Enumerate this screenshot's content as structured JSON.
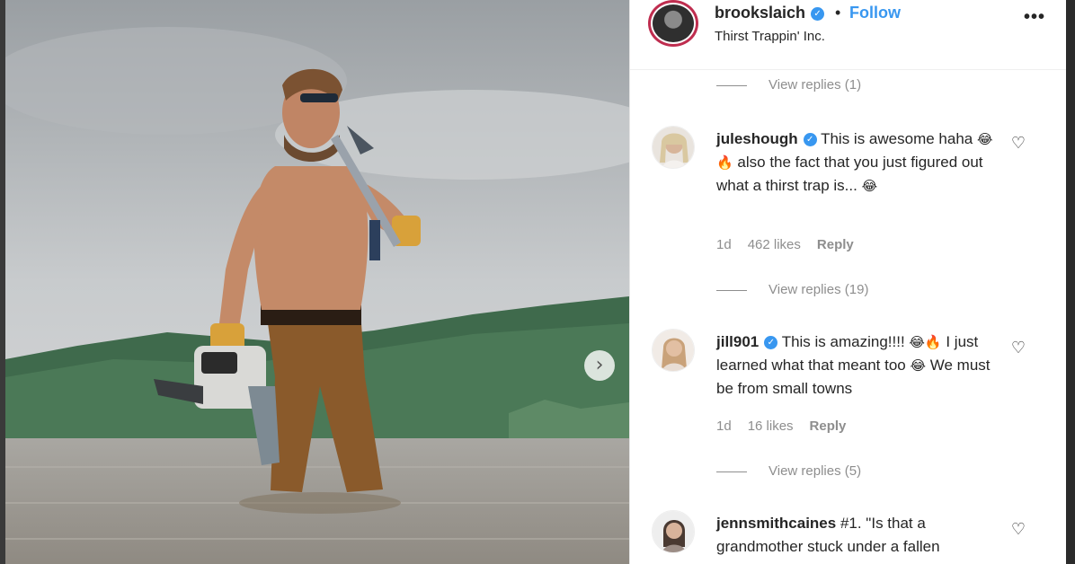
{
  "post": {
    "username": "brookslaich",
    "verified_icon": "verified-badge-icon",
    "dot": "•",
    "follow_label": "Follow",
    "subtitle": "Thirst Trappin' Inc.",
    "more_label": "•••",
    "next_glyph": "›"
  },
  "comments": {
    "view_replies_top": "View replies (1)",
    "items": [
      {
        "username": "juleshough",
        "text_1": "This is awesome haha ",
        "emoji_1": "😂🔥",
        "text_2": " also the fact that you just figured out what a thirst trap is... ",
        "emoji_2": "😂",
        "age": "1d",
        "likes": "462 likes",
        "reply_label": "Reply",
        "view_replies": "View replies (19)"
      },
      {
        "username": "jill901",
        "text_1": "This is amazing!!!! ",
        "emoji_1": "😂🔥",
        "text_2": " I just learned what that meant too ",
        "emoji_2": "😂",
        "text_3": " We must be from small towns",
        "age": "1d",
        "likes": "16 likes",
        "reply_label": "Reply",
        "view_replies": "View replies (5)"
      },
      {
        "username": "jennsmithcaines",
        "text_1": "#1. \"Is that a grandmother stuck under a fallen"
      }
    ]
  },
  "icons": {
    "heart": "♡"
  }
}
